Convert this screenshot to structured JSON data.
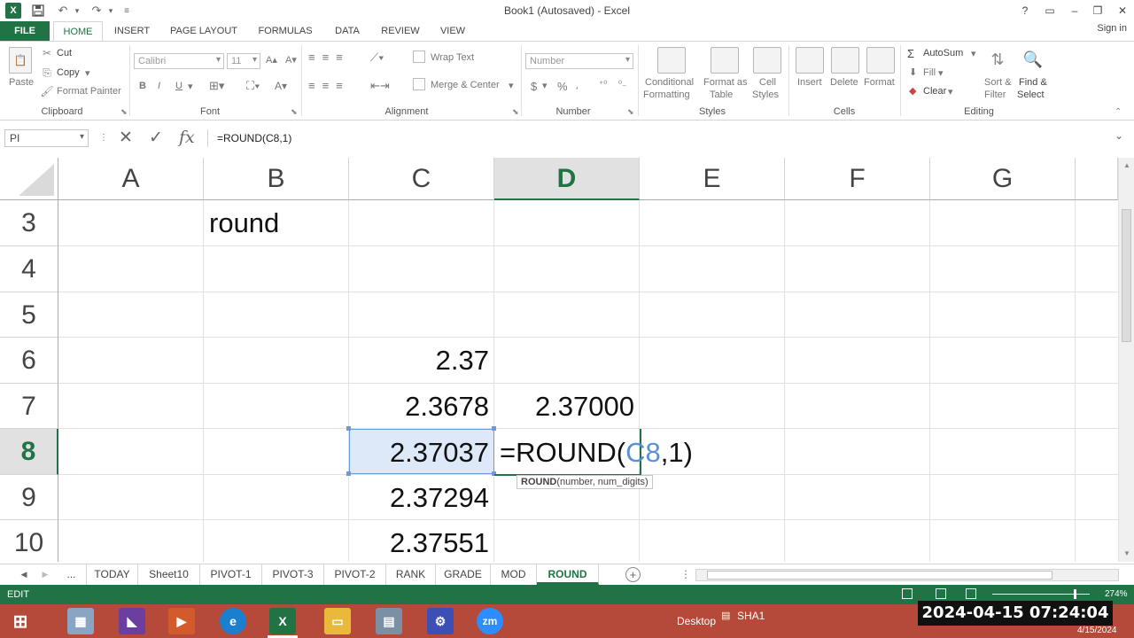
{
  "window": {
    "title": "Book1 (Autosaved) - Excel",
    "controls": [
      "?",
      "▭",
      "–",
      "❐",
      "✕"
    ]
  },
  "ribbon_tabs": [
    "FILE",
    "HOME",
    "INSERT",
    "PAGE LAYOUT",
    "FORMULAS",
    "DATA",
    "REVIEW",
    "VIEW"
  ],
  "active_ribbon_tab": "HOME",
  "signin": "Sign in",
  "clipboard": {
    "paste": "Paste",
    "cut": "Cut",
    "copy": "Copy",
    "format_painter": "Format Painter",
    "label": "Clipboard"
  },
  "font": {
    "name": "Calibri",
    "size": "11",
    "bold": "B",
    "italic": "I",
    "underline": "U",
    "label": "Font"
  },
  "alignment": {
    "wrap_text": "Wrap Text",
    "merge_center": "Merge & Center",
    "label": "Alignment"
  },
  "number": {
    "format": "Number",
    "currency": "$",
    "percent": "%",
    "label": "Number"
  },
  "styles": {
    "conditional": "Conditional",
    "conditional2": "Formatting",
    "format_as": "Format as",
    "format_as2": "Table",
    "cell": "Cell",
    "cell2": "Styles",
    "label": "Styles"
  },
  "cells": {
    "insert": "Insert",
    "delete": "Delete",
    "format": "Format",
    "label": "Cells"
  },
  "editing": {
    "autosum": "AutoSum",
    "fill": "Fill",
    "clear": "Clear",
    "sort": "Sort &",
    "sort2": "Filter",
    "find": "Find &",
    "find2": "Select",
    "label": "Editing"
  },
  "formula_bar": {
    "name_box": "PI",
    "formula": "=ROUND(C8,1)"
  },
  "columns": [
    "A",
    "B",
    "C",
    "D",
    "E",
    "F",
    "G"
  ],
  "selected_column": "D",
  "rows": [
    "3",
    "4",
    "5",
    "6",
    "7",
    "8",
    "9",
    "10"
  ],
  "selected_row": "8",
  "cells_data": {
    "B3": "round",
    "C6": "2.37",
    "C7": "2.3678",
    "D7": "2.37000",
    "C8": "2.37037",
    "C9": "2.37294",
    "C10": "2.37551"
  },
  "edit_formula": {
    "prefix": "=ROUND(",
    "ref": "C8",
    "suffix": ",1)"
  },
  "tooltip": {
    "fn": "ROUND",
    "args": "(number, num_digits)"
  },
  "sheet_tabs": [
    "...",
    "TODAY",
    "Sheet10",
    "PIVOT-1",
    "PIVOT-3",
    "PIVOT-2",
    "RANK",
    "GRADE",
    "MOD",
    "ROUND"
  ],
  "active_sheet": "ROUND",
  "status": {
    "mode": "EDIT",
    "zoom": "274%"
  },
  "taskbar": {
    "desktop": "Desktop",
    "sha": "SHA1",
    "date": "4/15/2024",
    "overlay_clock": "2024-04-15  07:24:04"
  },
  "colors": {
    "excel_green": "#217346",
    "taskbar": "#b5493a",
    "ref_blue": "#5b8fd6"
  }
}
